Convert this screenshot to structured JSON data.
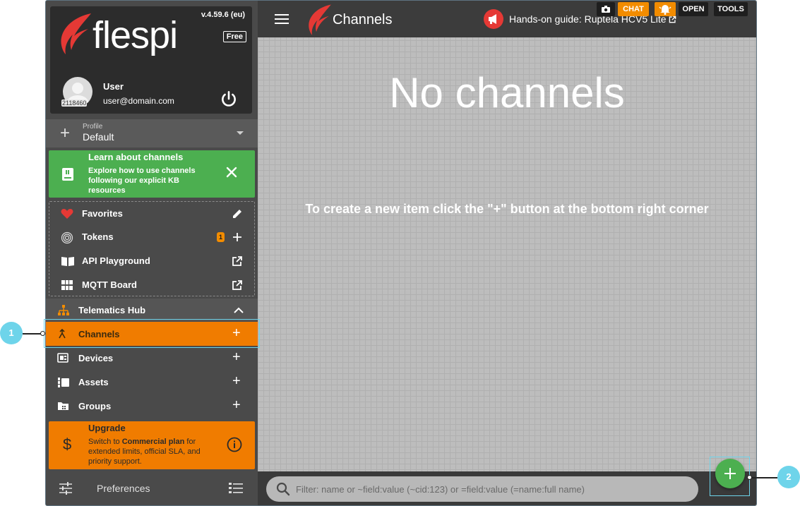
{
  "brand": {
    "name": "flespi",
    "version": "v.4.59.6 (eu)",
    "plan": "Free"
  },
  "user": {
    "name": "User",
    "email": "user@domain.com",
    "id": "2118460"
  },
  "profile": {
    "caption": "Profile",
    "value": "Default"
  },
  "learn": {
    "title": "Learn about channels",
    "desc": "Explore how to use channels following our explicit KB resources"
  },
  "favorites": [
    {
      "label": "Favorites",
      "icon": "heart-icon",
      "action": "pencil-icon"
    },
    {
      "label": "Tokens",
      "icon": "fingerprint-icon",
      "action": "plus-icon",
      "badge": "1"
    },
    {
      "label": "API Playground",
      "icon": "book-open-icon",
      "action": "external-link-icon"
    },
    {
      "label": "MQTT Board",
      "icon": "grid-icon",
      "action": "external-link-icon"
    }
  ],
  "hub": {
    "label": "Telematics Hub"
  },
  "nav": [
    {
      "label": "Channels",
      "icon": "merge-arrows-icon",
      "active": true
    },
    {
      "label": "Devices",
      "icon": "device-icon"
    },
    {
      "label": "Assets",
      "icon": "assets-icon"
    },
    {
      "label": "Groups",
      "icon": "folder-icon"
    }
  ],
  "upgrade": {
    "title": "Upgrade",
    "desc_prefix": "Switch to ",
    "desc_bold": "Commercial plan",
    "desc_suffix": " for extended limits, official SLA, and priority support."
  },
  "preferences": {
    "label": "Preferences"
  },
  "topbar": {
    "title": "Channels",
    "guide": "Hands-on guide: Ruptela HCV5 Lite",
    "buttons": [
      "CHAT",
      "OPEN",
      "TOOLS"
    ]
  },
  "main": {
    "empty_title": "No channels",
    "empty_hint": "To create a new item click the \"+\" button at the bottom right corner"
  },
  "search": {
    "placeholder": "Filter: name or ~field:value (~cid:123) or =field:value (=name:full name)"
  },
  "callouts": [
    "1",
    "2"
  ],
  "colors": {
    "accent_orange": "#f07c00",
    "success_green": "#4caf50",
    "brand_red": "#e53935",
    "callout_cyan": "#6ed4ea"
  }
}
